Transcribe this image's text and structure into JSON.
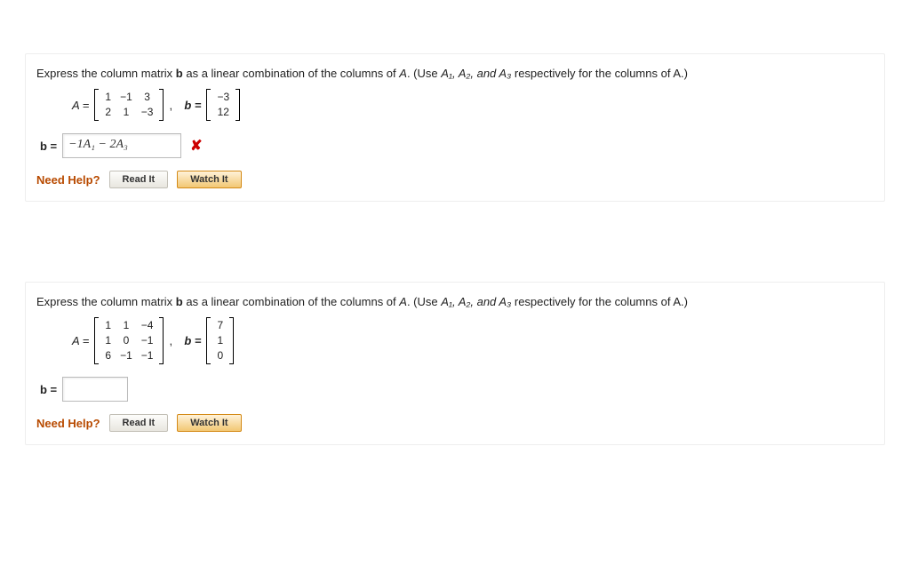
{
  "q1": {
    "prompt_prefix": "Express the column matrix ",
    "prompt_bold": "b",
    "prompt_mid": " as a linear combination of the columns of ",
    "prompt_A": "A",
    "prompt_tail": ". (Use ",
    "col_names": "A₁, A₂, and A₃",
    "prompt_end": " respectively for the columns of A.)",
    "A_label": "A =",
    "b_label": "b =",
    "A": [
      [
        "1",
        "−1",
        "3"
      ],
      [
        "2",
        "1",
        "−3"
      ]
    ],
    "b": [
      "−3",
      "12"
    ],
    "answer_label": "b =",
    "answer_value": "−1A₁ − 2A₃",
    "status": "✘",
    "help_label": "Need Help?",
    "read_btn": "Read It",
    "watch_btn": "Watch It"
  },
  "q2": {
    "prompt_prefix": "Express the column matrix ",
    "prompt_bold": "b",
    "prompt_mid": " as a linear combination of the columns of ",
    "prompt_A": "A",
    "prompt_tail": ". (Use ",
    "col_names": "A₁, A₂, and A₃",
    "prompt_end": " respectively for the columns of A.)",
    "A_label": "A =",
    "b_label": "b =",
    "A": [
      [
        "1",
        "1",
        "−4"
      ],
      [
        "1",
        "0",
        "−1"
      ],
      [
        "6",
        "−1",
        "−1"
      ]
    ],
    "b": [
      "7",
      "1",
      "0"
    ],
    "answer_label": "b =",
    "answer_value": "",
    "help_label": "Need Help?",
    "read_btn": "Read It",
    "watch_btn": "Watch It"
  }
}
